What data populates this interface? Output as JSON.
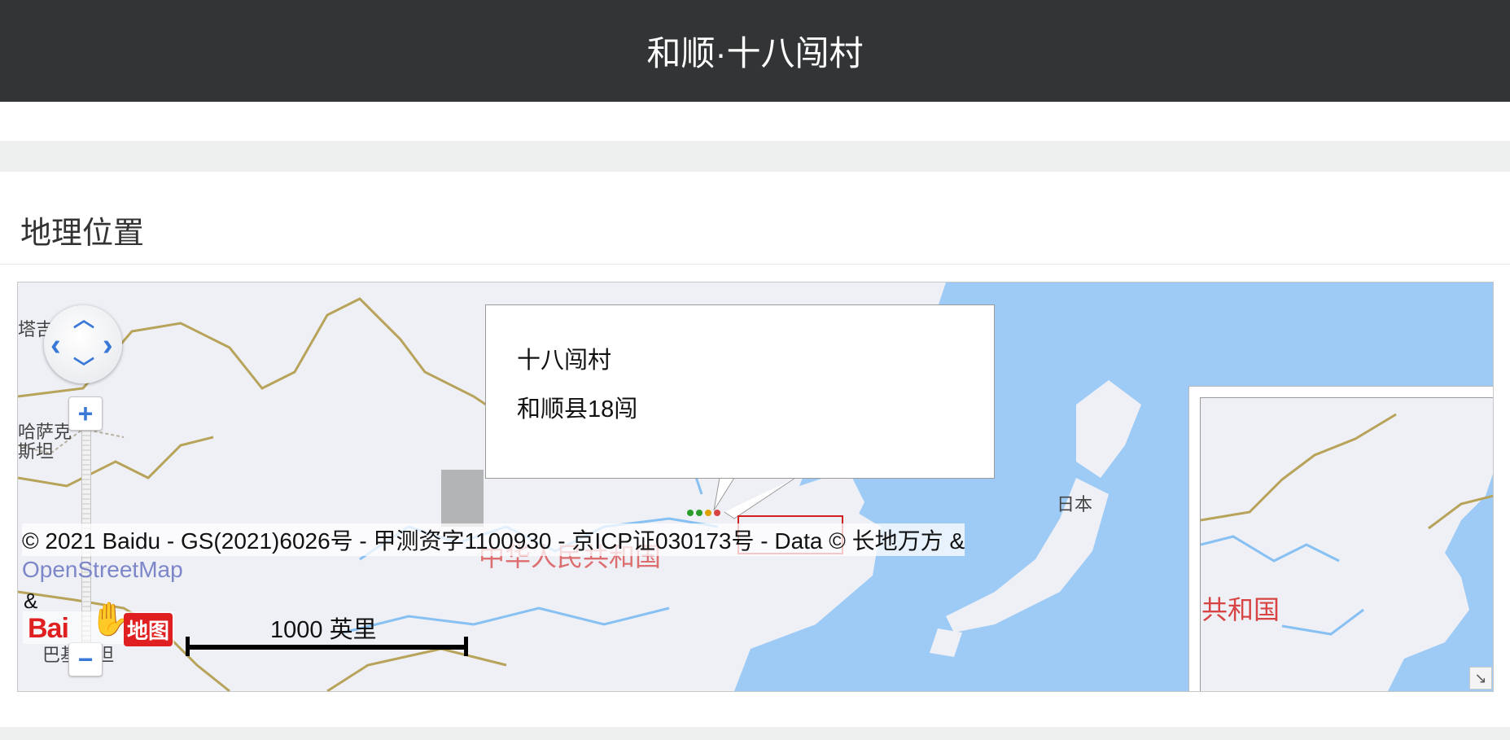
{
  "header": {
    "title": "和顺·十八闯村"
  },
  "section": {
    "title": "地理位置"
  },
  "map": {
    "popup": {
      "name": "十八闯村",
      "address": "和顺县18闯"
    },
    "copyright": "© 2021 Baidu - GS(2021)6026号 - 甲测资字1100930 - 京ICP证030173号 - Data © 长地万方 &",
    "osm_link": "OpenStreetMap",
    "amp": "&",
    "logo": {
      "text_a": "Bai",
      "text_b": "地图"
    },
    "scale_label": "1000 英里",
    "labels": {
      "tajik": "塔吉克",
      "kazakh": "哈萨克\n斯坦",
      "pakistan": "巴基斯坦",
      "japan": "日本",
      "china": "中华人民共和国",
      "overview_country": "共和国"
    },
    "controls": {
      "zoom_in": "+",
      "zoom_out": "−",
      "pan_up": "︿",
      "pan_down": "﹀",
      "pan_left": "‹",
      "pan_right": "›",
      "overview_toggle": "↘"
    },
    "colors": {
      "land": "#eef0f6",
      "water": "#9ecbf5",
      "border": "#b8a35a",
      "river": "#87c0f3",
      "china_label": "#d84343"
    }
  }
}
